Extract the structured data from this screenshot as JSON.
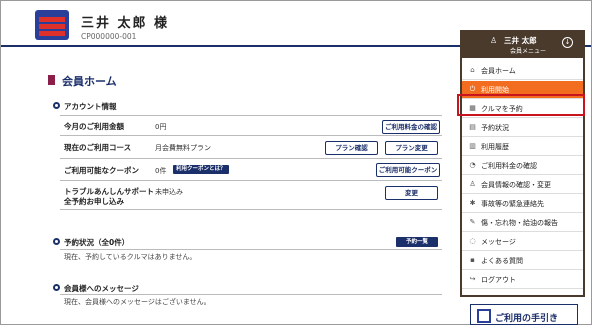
{
  "header": {
    "user_name": "三井 太郎 様",
    "user_id": "CP000000-001"
  },
  "page": {
    "title": "会員ホーム"
  },
  "account": {
    "heading": "アカウント情報",
    "rows": [
      {
        "label": "今月のご利用金額",
        "value": "0円",
        "buttons": [
          "ご利用料金の確認"
        ]
      },
      {
        "label": "現在のご利用コース",
        "value": "月会費無料プラン",
        "buttons": [
          "プラン確認",
          "プラン変更"
        ]
      },
      {
        "label": "ご利用可能なクーポン",
        "value": "0件",
        "badge": "利用クーポンとは？",
        "buttons": [
          "ご利用可能クーポン"
        ]
      },
      {
        "label": "トラブルあんしんサポート",
        "label2": "全予約お申し込み",
        "value": "未申込み",
        "buttons": [
          "変更"
        ]
      }
    ]
  },
  "reservation": {
    "heading": "予約状況（全0件）",
    "button": "予約一覧",
    "note": "現在、予約しているクルマはありません。"
  },
  "messages": {
    "heading": "会員様へのメッセージ",
    "note": "現在、会員様へのメッセージはございません。"
  },
  "menu": {
    "name": "三井 太郎",
    "subtitle": "会員メニュー",
    "items": [
      {
        "label": "会員ホーム",
        "icon": "home-icon",
        "glyph": "⌂"
      },
      {
        "label": "利用開始",
        "icon": "power-icon",
        "glyph": "⏻",
        "active": true
      },
      {
        "label": "クルマを予約",
        "icon": "calendar-icon",
        "glyph": "▦"
      },
      {
        "label": "予約状況",
        "icon": "document-icon",
        "glyph": "▤"
      },
      {
        "label": "利用履歴",
        "icon": "history-icon",
        "glyph": "▥"
      },
      {
        "label": "ご利用料金の確認",
        "icon": "fee-icon",
        "glyph": "◔"
      },
      {
        "label": "会員情報の確認・変更",
        "icon": "person-icon",
        "glyph": "♙"
      },
      {
        "label": "事故等の緊急連絡先",
        "icon": "emergency-icon",
        "glyph": "✱"
      },
      {
        "label": "傷・忘れ物・給油の報告",
        "icon": "report-icon",
        "glyph": "✎"
      },
      {
        "label": "メッセージ",
        "icon": "message-icon",
        "glyph": "◌"
      },
      {
        "label": "よくある質問",
        "icon": "faq-icon",
        "glyph": "▪"
      },
      {
        "label": "ログアウト",
        "icon": "logout-icon",
        "glyph": "↪"
      }
    ]
  },
  "guide": {
    "label": "ご利用の手引き"
  },
  "colors": {
    "navy": "#1b2f6b",
    "orange": "#f26d1f",
    "highlight_red": "#c8141e",
    "menu_brown": "#4a3a2c"
  }
}
